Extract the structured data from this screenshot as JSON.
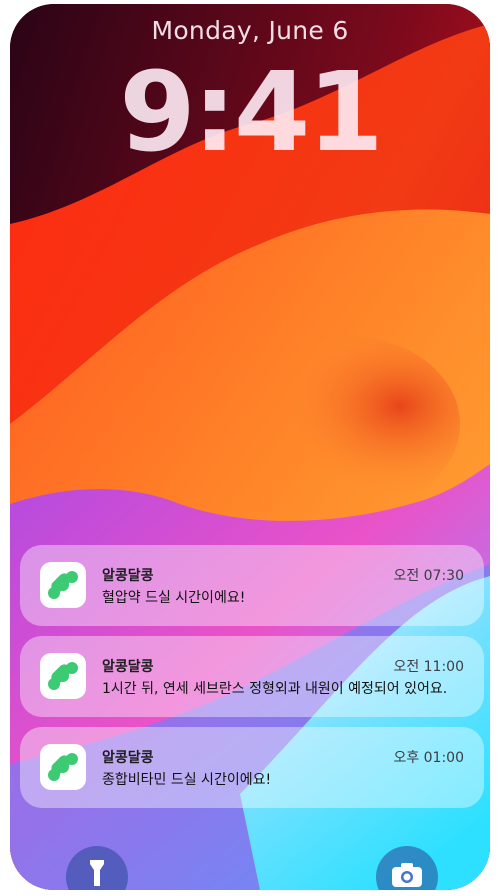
{
  "lock_screen": {
    "date": "Monday, June 6",
    "time": "9:41"
  },
  "notifications": [
    {
      "app": "알콩달콩",
      "time": "오전 07:30",
      "message": "혈압약 드실 시간이에요!"
    },
    {
      "app": "알콩달콩",
      "time": "오전 11:00",
      "message": "1시간 뒤, 연세 세브란스 정형외과 내원이 예정되어 있어요."
    },
    {
      "app": "알콩달콩",
      "time": "오후 01:00",
      "message": "종합비타민 드실 시간이에요!"
    }
  ],
  "quick_actions": {
    "left_icon": "flashlight-icon",
    "right_icon": "camera-icon"
  },
  "colors": {
    "app_icon_green": "#3ccb73"
  }
}
